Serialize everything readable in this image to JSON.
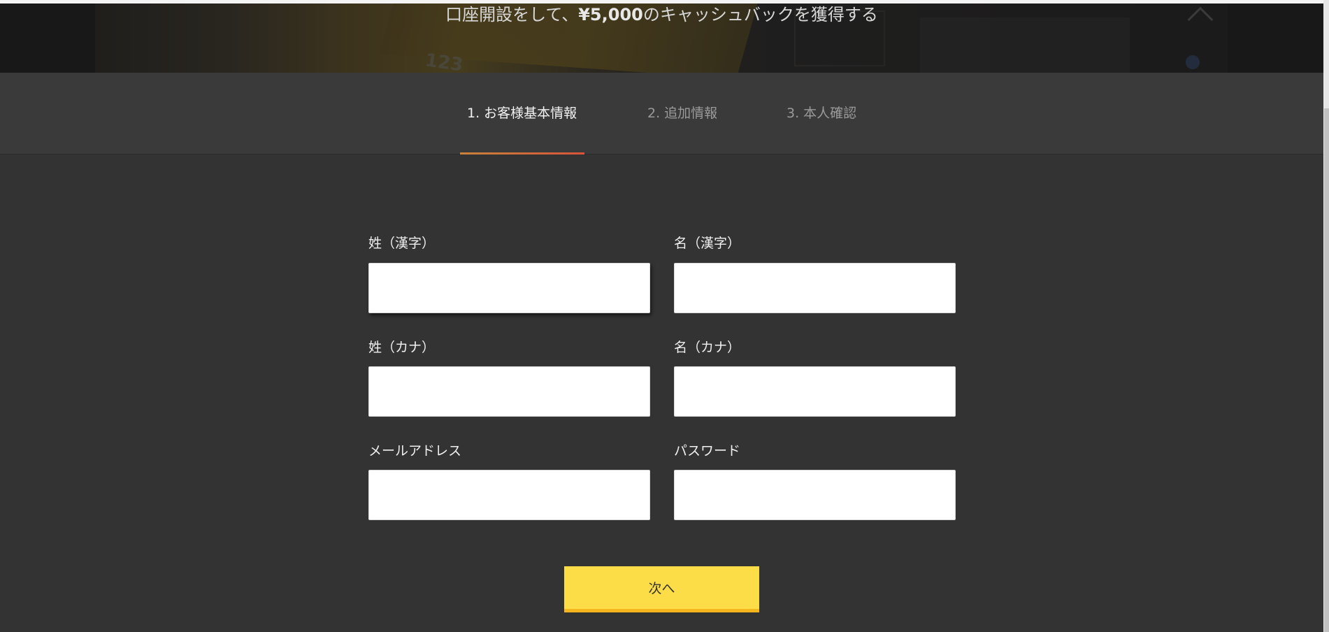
{
  "hero": {
    "title_prefix": "口座開設をして、",
    "title_amount": "¥5,000",
    "title_suffix": "のキャッシュバックを獲得する",
    "background_deco_text": "123"
  },
  "steps": [
    {
      "label": "1. お客様基本情報",
      "active": true
    },
    {
      "label": "2. 追加情報",
      "active": false
    },
    {
      "label": "3. 本人確認",
      "active": false
    }
  ],
  "form": {
    "last_name_kanji": {
      "label": "姓（漢字）",
      "value": ""
    },
    "first_name_kanji": {
      "label": "名（漢字）",
      "value": ""
    },
    "last_name_kana": {
      "label": "姓（カナ）",
      "value": ""
    },
    "first_name_kana": {
      "label": "名（カナ）",
      "value": ""
    },
    "email": {
      "label": "メールアドレス",
      "value": ""
    },
    "password": {
      "label": "パスワード",
      "value": ""
    }
  },
  "next_button": {
    "label": "次へ"
  },
  "colors": {
    "background": "#333333",
    "step_header": "#3a3a3a",
    "active_underline": "#d8543a",
    "button": "#fddd47",
    "button_border": "#f5b61d"
  }
}
